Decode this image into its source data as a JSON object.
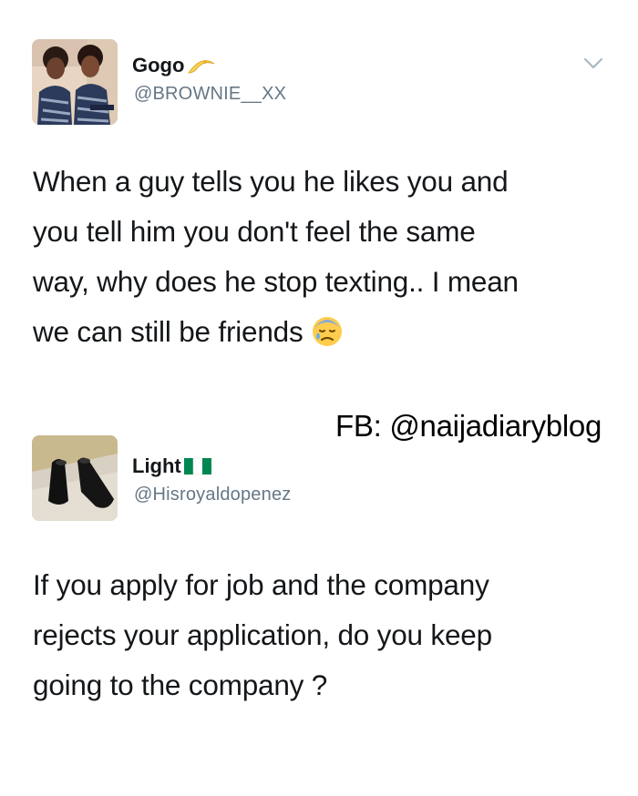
{
  "tweets": [
    {
      "display_name": "Gogo",
      "name_emoji": "moon-icon",
      "handle": "@BROWNIE__XX",
      "text_lines": [
        "When a guy tells you he likes you and",
        "you tell him you don't feel the same",
        "way, why does he stop texting.. I mean",
        "we can still be friends"
      ],
      "text_emoji": "disappointed-sweat-face-icon"
    },
    {
      "display_name": "Light",
      "name_emoji": "nigeria-flag-icon",
      "handle": "@Hisroyaldopenez",
      "text_lines": [
        "If you apply for job and the company",
        "rejects your application, do you keep",
        "going to the company ?"
      ]
    }
  ],
  "watermark": "FB: @naijadiaryblog",
  "colors": {
    "text": "#14171a",
    "handle": "#657786",
    "chevron": "#aab8c2",
    "flag_green": "#008751"
  }
}
